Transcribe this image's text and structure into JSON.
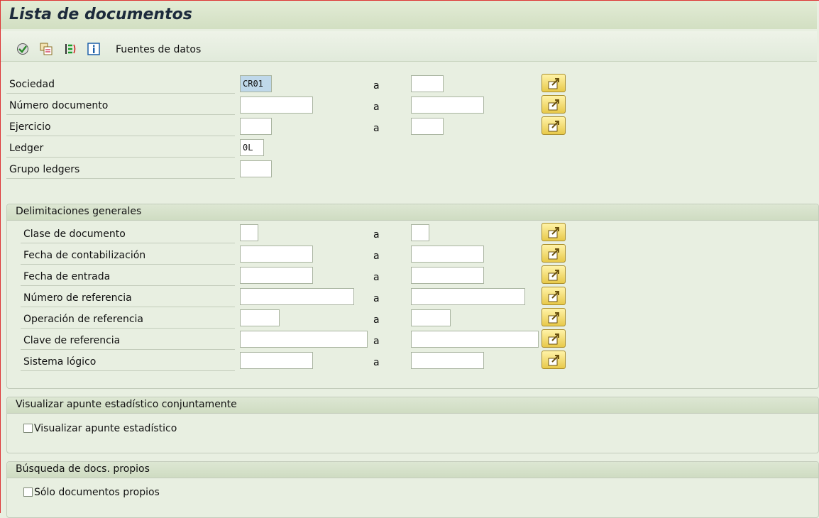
{
  "window": {
    "title": "Lista de documentos"
  },
  "toolbar": {
    "icons": [
      "execute-icon",
      "variant-icon",
      "selection-options-icon",
      "info-icon"
    ],
    "data_sources_label": "Fuentes de datos"
  },
  "main": {
    "rows": [
      {
        "label": "Sociedad",
        "from": "CR01",
        "to": "",
        "range_sep": "a"
      },
      {
        "label": "Número documento",
        "from": "",
        "to": "",
        "range_sep": "a"
      },
      {
        "label": "Ejercicio",
        "from": "",
        "to": "",
        "range_sep": "a"
      },
      {
        "label": "Ledger",
        "from": "0L"
      },
      {
        "label": "Grupo ledgers",
        "from": ""
      }
    ]
  },
  "general": {
    "title": "Delimitaciones generales",
    "rows": [
      {
        "label": "Clase de documento",
        "from": "",
        "to": "",
        "range_sep": "a"
      },
      {
        "label": "Fecha de contabilización",
        "from": "",
        "to": "",
        "range_sep": "a"
      },
      {
        "label": "Fecha de entrada",
        "from": "",
        "to": "",
        "range_sep": "a"
      },
      {
        "label": "Número de referencia",
        "from": "",
        "to": "",
        "range_sep": "a"
      },
      {
        "label": "Operación de referencia",
        "from": "",
        "to": "",
        "range_sep": "a"
      },
      {
        "label": "Clave de referencia",
        "from": "",
        "to": "",
        "range_sep": "a"
      },
      {
        "label": "Sistema lógico",
        "from": "",
        "to": "",
        "range_sep": "a"
      }
    ]
  },
  "statistical": {
    "title": "Visualizar apunte estadístico conjuntamente",
    "checkbox_label": "Visualizar apunte estadístico",
    "checked": false
  },
  "own_docs": {
    "title": "Búsqueda de docs. propios",
    "checkbox_label": "Sólo documentos propios",
    "checked": false
  },
  "colors": {
    "title_text": "#1c2a3b",
    "background": "#e8efe1",
    "selected_field": "#bfd8ea",
    "multi_button": "#f2d65e"
  }
}
